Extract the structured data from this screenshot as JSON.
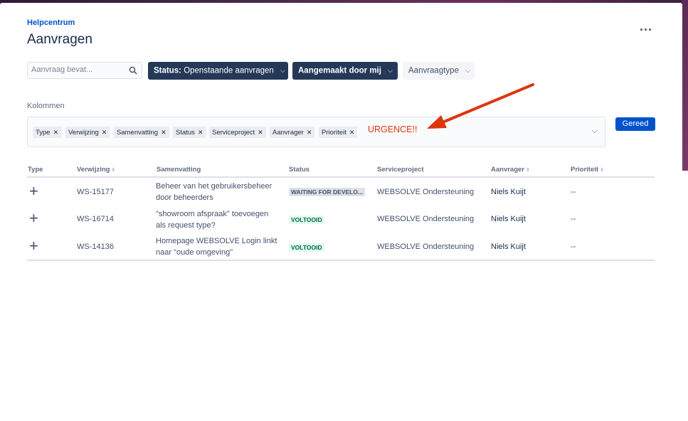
{
  "header": {
    "breadcrumb": "Helpcentrum",
    "title": "Aanvragen",
    "more": "..."
  },
  "filters": {
    "search_placeholder": "Aanvraag bevat...",
    "status_prefix": "Status:",
    "status_value": "Openstaande aanvragen",
    "created_by": "Aangemaakt door mij",
    "request_type": "Aanvraagtype"
  },
  "columns_editor": {
    "label": "Kolommen",
    "tags": [
      "Type",
      "Verwijzing",
      "Samenvatting",
      "Status",
      "Serviceproject",
      "Aanvrager",
      "Prioriteit"
    ],
    "done_button": "Gereed"
  },
  "annotation": {
    "text": "URGENCE!!",
    "color": "#de350b"
  },
  "table": {
    "headers": [
      "Type",
      "Verwijzing",
      "Samenvatting",
      "Status",
      "Serviceproject",
      "Aanvrager",
      "Prioriteit"
    ],
    "rows": [
      {
        "type_icon": "plus-icon",
        "ref": "WS-15177",
        "summary": "Beheer van het gebruikersbeheer door beheerders",
        "status": "WAITING FOR DEVELO...",
        "project": "WEBSOLVE Ondersteuning",
        "requester": "Niels Kuijt",
        "priority": "--"
      },
      {
        "type_icon": "plus-icon",
        "ref": "WS-16714",
        "summary": "\"showroom afspraak\" toevoegen als request type?",
        "status": "VOLTOOID",
        "project": "WEBSOLVE Ondersteuning",
        "requester": "Niels Kuijt",
        "priority": "--"
      },
      {
        "type_icon": "plus-icon",
        "ref": "WS-14136",
        "summary": "Homepage WEBSOLVE Login linkt naar \"oude omgeving\"",
        "status": "VOLTOOID",
        "project": "WEBSOLVE Ondersteuning",
        "requester": "Niels Kuijt",
        "priority": "--"
      }
    ]
  },
  "colors": {
    "primary": "#0052cc",
    "dark_button": "#253858",
    "success_bg": "#e3fcef",
    "success_text": "#006644"
  }
}
